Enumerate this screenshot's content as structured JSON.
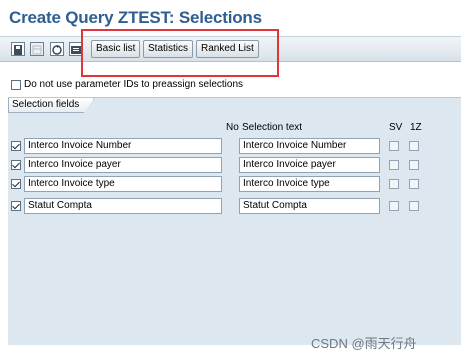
{
  "window": {
    "title": "Create Query ZTEST: Selections"
  },
  "toolbar": {
    "icons": [
      "save-icon",
      "layout-icon",
      "refresh-icon",
      "info-icon"
    ],
    "basic_list_label": "Basic list",
    "statistics_label": "Statistics",
    "ranked_list_label": "Ranked List"
  },
  "options": {
    "no_param_ids_label": "Do not use parameter IDs to preassign selections",
    "no_param_ids_checked": false
  },
  "selection_fields": {
    "tab_label": "Selection fields",
    "headers": {
      "no": "No",
      "selection_text": "Selection text",
      "sv": "SV",
      "one_z": "1Z"
    },
    "rows": [
      {
        "checked": true,
        "field": "Interco Invoice Number",
        "text": "Interco Invoice Number"
      },
      {
        "checked": true,
        "field": "Interco Invoice payer",
        "text": "Interco Invoice payer"
      },
      {
        "checked": true,
        "field": "Interco Invoice type",
        "text": "Interco Invoice type"
      },
      {
        "checked": true,
        "field": "Statut Compta",
        "text": "Statut Compta"
      }
    ]
  },
  "watermark": {
    "text": "CSDN @雨天行舟"
  },
  "colors": {
    "title": "#2f5f91",
    "highlight": "#e0353b",
    "panel_bg": "#dde7ef"
  }
}
